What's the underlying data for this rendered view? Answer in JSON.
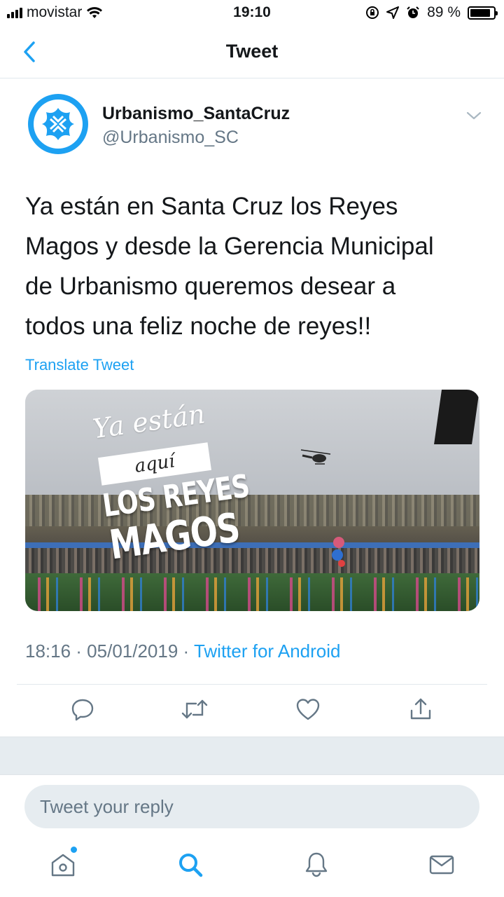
{
  "status_bar": {
    "carrier": "movistar",
    "time": "19:10",
    "battery_percent": "89 %",
    "battery_level": 0.89
  },
  "nav": {
    "title": "Tweet",
    "back_icon": "chevron-left-icon"
  },
  "tweet": {
    "display_name": "Urbanismo_SantaCruz",
    "handle": "@Urbanismo_SC",
    "text_lines": [
      "Ya están en Santa Cruz los Reyes",
      "Magos y desde la Gerencia Municipal",
      "de Urbanismo queremos desear a",
      "todos una feliz noche de reyes!!"
    ],
    "translate_label": "Translate Tweet",
    "media_overlay": {
      "line1": "Ya están",
      "line2": "aquí",
      "line3": "LOS REYES",
      "line4": "MAGOS"
    },
    "timestamp": "18:16 · 05/01/2019 · ",
    "source": "Twitter for Android"
  },
  "actions": [
    "reply-icon",
    "retweet-icon",
    "like-icon",
    "share-icon"
  ],
  "reply": {
    "placeholder": "Tweet your reply"
  },
  "tabs": [
    "home-icon",
    "search-icon",
    "notifications-icon",
    "messages-icon"
  ],
  "colors": {
    "accent": "#1da1f2",
    "secondary_text": "#657786",
    "band": "#e6ecf0"
  }
}
